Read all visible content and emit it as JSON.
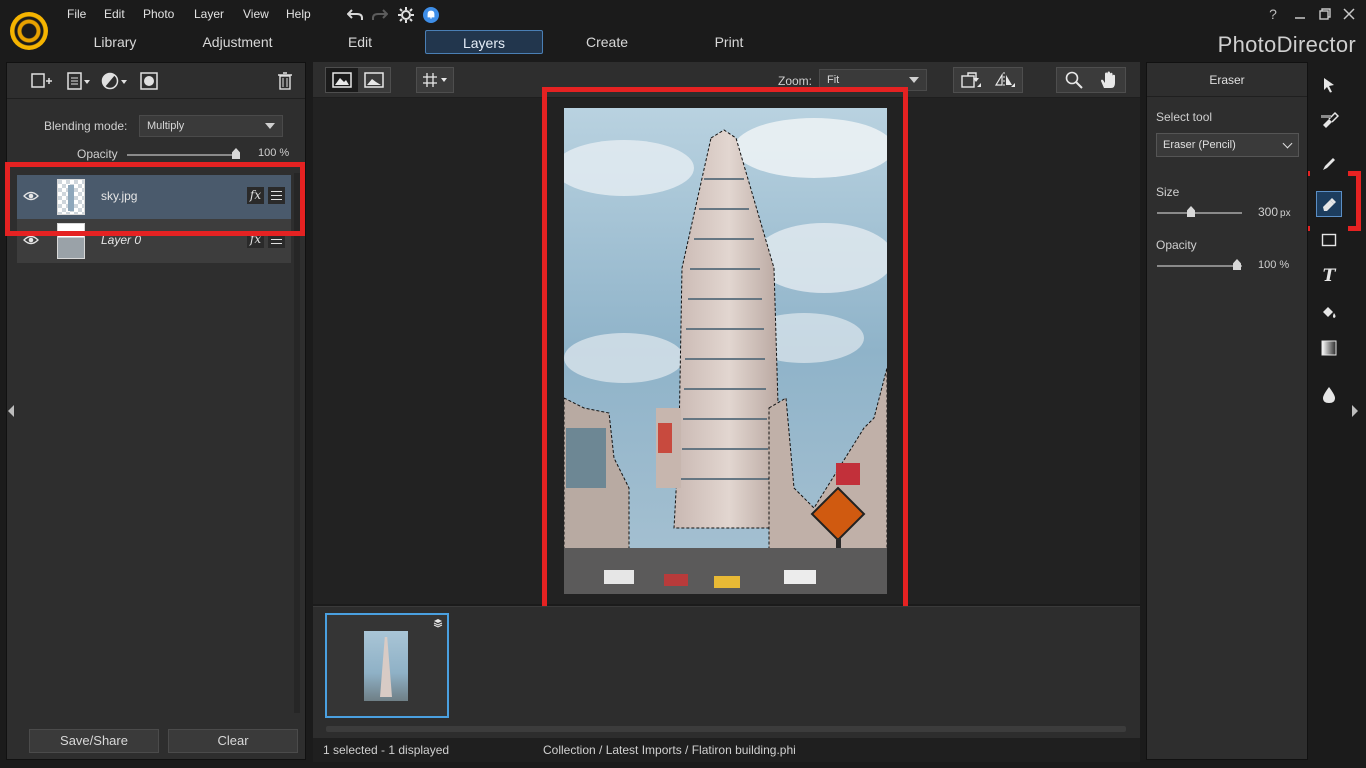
{
  "app": {
    "title": "PhotoDirector"
  },
  "menu": [
    "File",
    "Edit",
    "Photo",
    "Layer",
    "View",
    "Help"
  ],
  "tabs": [
    {
      "label": "Library"
    },
    {
      "label": "Adjustment"
    },
    {
      "label": "Edit"
    },
    {
      "label": "Layers",
      "active": true
    },
    {
      "label": "Create"
    },
    {
      "label": "Print"
    }
  ],
  "window_controls": {
    "help": "?"
  },
  "layers_panel": {
    "blending_label": "Blending mode:",
    "blending_value": "Multiply",
    "opacity_label": "Opacity",
    "opacity_value": "100 %",
    "opacity_fraction": 1.0,
    "layers": [
      {
        "name": "sky.jpg",
        "selected": true,
        "visible": true
      },
      {
        "name": "Layer 0",
        "selected": false,
        "visible": true
      }
    ],
    "save_share": "Save/Share",
    "clear": "Clear"
  },
  "canvas": {
    "zoom_label": "Zoom:",
    "zoom_value": "Fit"
  },
  "status": {
    "selection": "1 selected - 1 displayed",
    "path": "Collection / Latest Imports / Flatiron building.phi"
  },
  "eraser_panel": {
    "title": "Eraser",
    "select_tool_label": "Select tool",
    "select_tool_value": "Eraser (Pencil)",
    "size_label": "Size",
    "size_value": "300",
    "size_unit": "px",
    "size_fraction": 0.4,
    "opacity_label": "Opacity",
    "opacity_value": "100 %",
    "opacity_fraction": 1.0
  },
  "colors": {
    "accent": "#4a7fb5",
    "highlight": "#e52222",
    "selected_layer": "#4a5a6c",
    "app_bg": "#1b1b1b",
    "panel_bg": "#2e2e2e"
  },
  "icons": [
    "logo",
    "undo-icon",
    "redo-icon",
    "settings-icon",
    "notification-icon",
    "minimize-icon",
    "restore-icon",
    "close-icon",
    "add-layer-icon",
    "layer-menu-icon",
    "adjustment-icon",
    "mask-icon",
    "trash-icon",
    "eye-icon",
    "fx-icon",
    "adjust-icon",
    "view-before-after-icon",
    "view-single-icon",
    "grid-icon",
    "rotate-icon",
    "flip-icon",
    "magnifier-icon",
    "hand-icon",
    "arrow-select-icon",
    "brush-icon",
    "pen-icon",
    "eraser-icon",
    "rectangle-icon",
    "text-icon",
    "fill-icon",
    "gradient-icon",
    "drop-icon"
  ]
}
